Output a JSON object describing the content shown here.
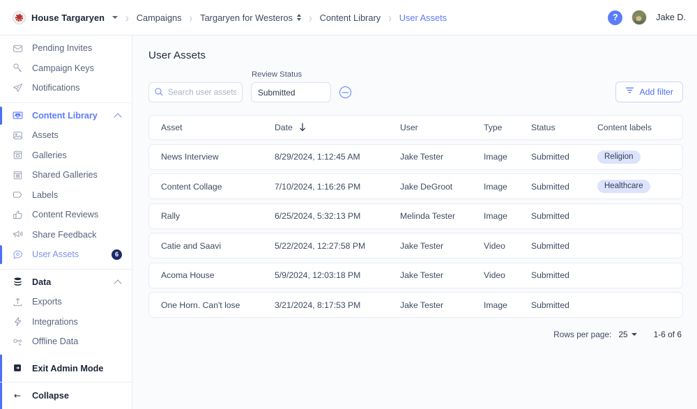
{
  "topbar": {
    "org": {
      "name": "House Targaryen",
      "logo_icon": "house-targaryen-logo"
    },
    "breadcrumbs": [
      {
        "label": "Campaigns",
        "active": false
      },
      {
        "label": "Targaryen for Westeros",
        "active": false,
        "has_switcher": true
      },
      {
        "label": "Content Library",
        "active": false
      },
      {
        "label": "User Assets",
        "active": true
      }
    ],
    "help_label": "?",
    "user_name": "Jake D."
  },
  "sidebar": {
    "groups": [
      {
        "items": [
          {
            "label": "Pending Invites",
            "icon": "envelope-icon"
          },
          {
            "label": "Campaign Keys",
            "icon": "key-icon"
          },
          {
            "label": "Notifications",
            "icon": "paper-plane-icon"
          }
        ]
      },
      {
        "items": [
          {
            "label": "Content Library",
            "icon": "inbox-icon",
            "state": "active",
            "expanded": true
          },
          {
            "label": "Assets",
            "icon": "image-icon"
          },
          {
            "label": "Galleries",
            "icon": "gallery-icon"
          },
          {
            "label": "Shared Galleries",
            "icon": "shared-gallery-icon"
          },
          {
            "label": "Labels",
            "icon": "tag-icon"
          },
          {
            "label": "Content Reviews",
            "icon": "thumbs-up-icon"
          },
          {
            "label": "Share Feedback",
            "icon": "megaphone-icon"
          },
          {
            "label": "User Assets",
            "icon": "chat-icon",
            "state": "activeleaf",
            "badge": "6"
          }
        ]
      },
      {
        "items": [
          {
            "label": "Data",
            "icon": "database-icon",
            "state": "section",
            "expanded": true
          },
          {
            "label": "Exports",
            "icon": "upload-icon"
          },
          {
            "label": "Integrations",
            "icon": "bolt-icon"
          },
          {
            "label": "Offline Data",
            "icon": "offline-icon"
          }
        ]
      }
    ],
    "bottom": [
      {
        "label": "Exit Admin Mode",
        "icon": "exit-icon"
      },
      {
        "label": "Collapse",
        "icon": "arrow-left-icon"
      }
    ]
  },
  "main": {
    "title": "User Assets",
    "search": {
      "placeholder": "Search user assets",
      "value": "",
      "icon": "search-icon"
    },
    "review_status": {
      "label": "Review Status",
      "value": "Submitted"
    },
    "remove_filter_icon": "minus-circle-icon",
    "add_filter": {
      "label": "Add filter",
      "icon": "filter-icon"
    },
    "table": {
      "columns": [
        {
          "key": "asset",
          "label": "Asset"
        },
        {
          "key": "date",
          "label": "Date",
          "sorted": "desc",
          "sort_icon": "arrow-down-icon"
        },
        {
          "key": "user",
          "label": "User"
        },
        {
          "key": "type",
          "label": "Type"
        },
        {
          "key": "status",
          "label": "Status"
        },
        {
          "key": "labels",
          "label": "Content labels"
        }
      ],
      "rows": [
        {
          "asset": "News Interview",
          "date": "8/29/2024, 1:12:45 AM",
          "user": "Jake Tester",
          "type": "Image",
          "status": "Submitted",
          "labels": [
            "Religion"
          ]
        },
        {
          "asset": "Content Collage",
          "date": "7/10/2024, 1:16:26 PM",
          "user": "Jake DeGroot",
          "type": "Image",
          "status": "Submitted",
          "labels": [
            "Healthcare"
          ]
        },
        {
          "asset": "Rally",
          "date": "6/25/2024, 5:32:13 PM",
          "user": "Melinda Tester",
          "type": "Image",
          "status": "Submitted",
          "labels": []
        },
        {
          "asset": "Catie and Saavi",
          "date": "5/22/2024, 12:27:58 PM",
          "user": "Jake Tester",
          "type": "Video",
          "status": "Submitted",
          "labels": []
        },
        {
          "asset": "Acoma House",
          "date": "5/9/2024, 12:03:18 PM",
          "user": "Jake Tester",
          "type": "Video",
          "status": "Submitted",
          "labels": []
        },
        {
          "asset": "One Horn. Can't lose",
          "date": "3/21/2024, 8:17:53 PM",
          "user": "Jake Tester",
          "type": "Image",
          "status": "Submitted",
          "labels": []
        }
      ]
    },
    "pagination": {
      "rows_per_page_label": "Rows per page:",
      "rows_per_page_value": "25",
      "range": "1-6 of 6"
    }
  },
  "colors": {
    "accent": "#4d6ff5",
    "link": "#5b7cfa",
    "chip_bg": "#dde3fb",
    "badge_bg": "#1b2a6b",
    "page_bg": "#fafbfd",
    "border": "#e8ecf3"
  }
}
